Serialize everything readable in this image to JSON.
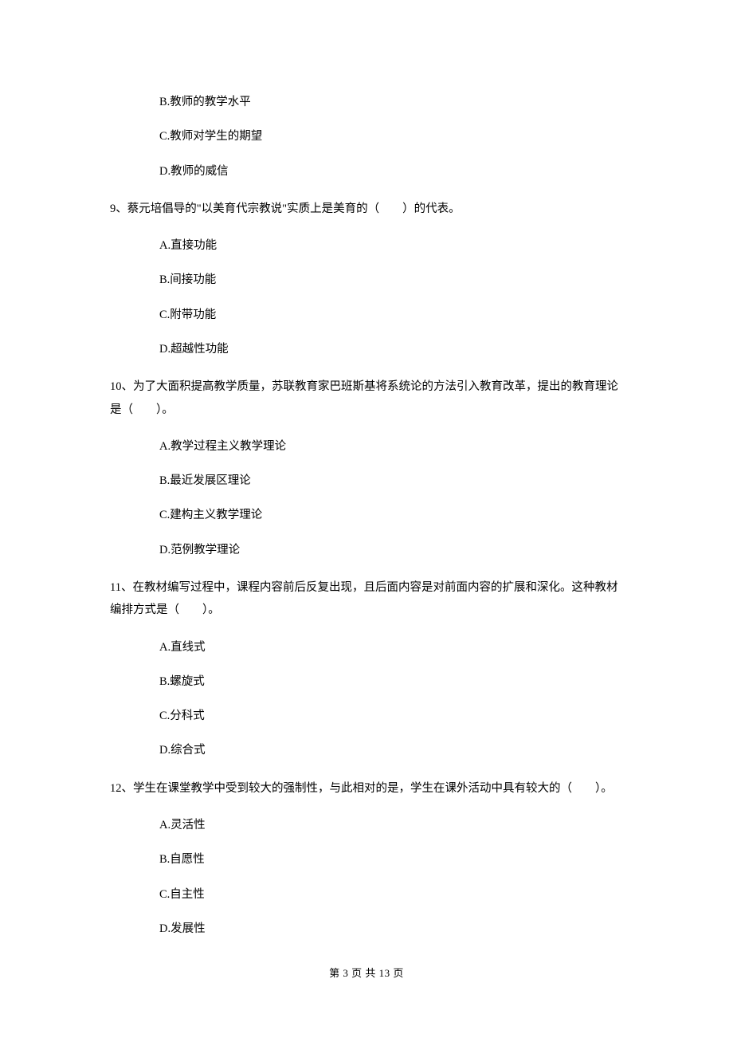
{
  "q8": {
    "optB": "B.教师的教学水平",
    "optC": "C.教师对学生的期望",
    "optD": "D.教师的威信"
  },
  "q9": {
    "stem": "9、蔡元培倡导的\"以美育代宗教说\"实质上是美育的（　　）的代表。",
    "optA": "A.直接功能",
    "optB": "B.间接功能",
    "optC": "C.附带功能",
    "optD": "D.超越性功能"
  },
  "q10": {
    "stem": "10、为了大面积提高教学质量，苏联教育家巴班斯基将系统论的方法引入教育改革，提出的教育理论是（　　）。",
    "optA": "A.教学过程主义教学理论",
    "optB": "B.最近发展区理论",
    "optC": "C.建构主义教学理论",
    "optD": "D.范例教学理论"
  },
  "q11": {
    "stem": "11、在教材编写过程中，课程内容前后反复出现，且后面内容是对前面内容的扩展和深化。这种教材编排方式是（　　）。",
    "optA": "A.直线式",
    "optB": "B.螺旋式",
    "optC": "C.分科式",
    "optD": "D.综合式"
  },
  "q12": {
    "stem": "12、学生在课堂教学中受到较大的强制性，与此相对的是，学生在课外活动中具有较大的（　　）。",
    "optA": "A.灵活性",
    "optB": "B.自愿性",
    "optC": "C.自主性",
    "optD": "D.发展性"
  },
  "footer": "第 3 页 共 13 页"
}
